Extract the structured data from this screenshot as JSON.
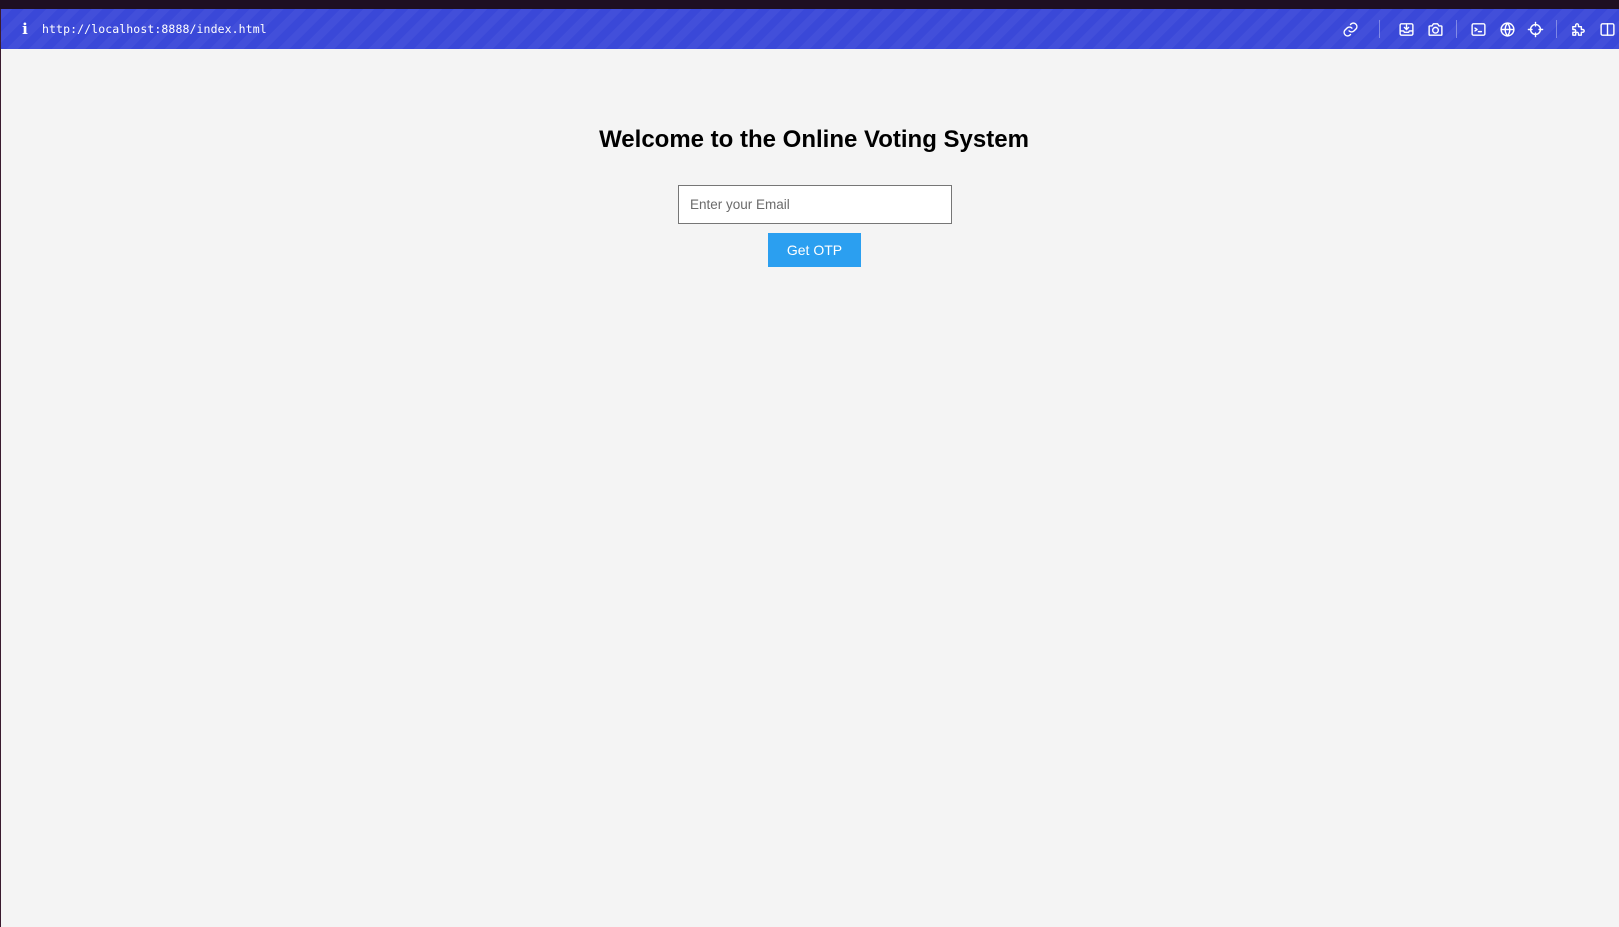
{
  "browser": {
    "url": "http://localhost:8888/index.html",
    "info_icon": "i",
    "toolbar_icons": [
      "link-icon",
      "download-icon",
      "camera-icon",
      "terminal-icon",
      "globe-icon",
      "crosshair-icon",
      "extension-icon",
      "sidebar-icon"
    ],
    "accent_color": "#3a48d8"
  },
  "page": {
    "title": "Welcome to the Online Voting System",
    "email_placeholder": "Enter your Email",
    "email_value": "",
    "otp_button_label": "Get OTP",
    "button_color": "#2b9ff0",
    "background_color": "#f4f4f4"
  }
}
